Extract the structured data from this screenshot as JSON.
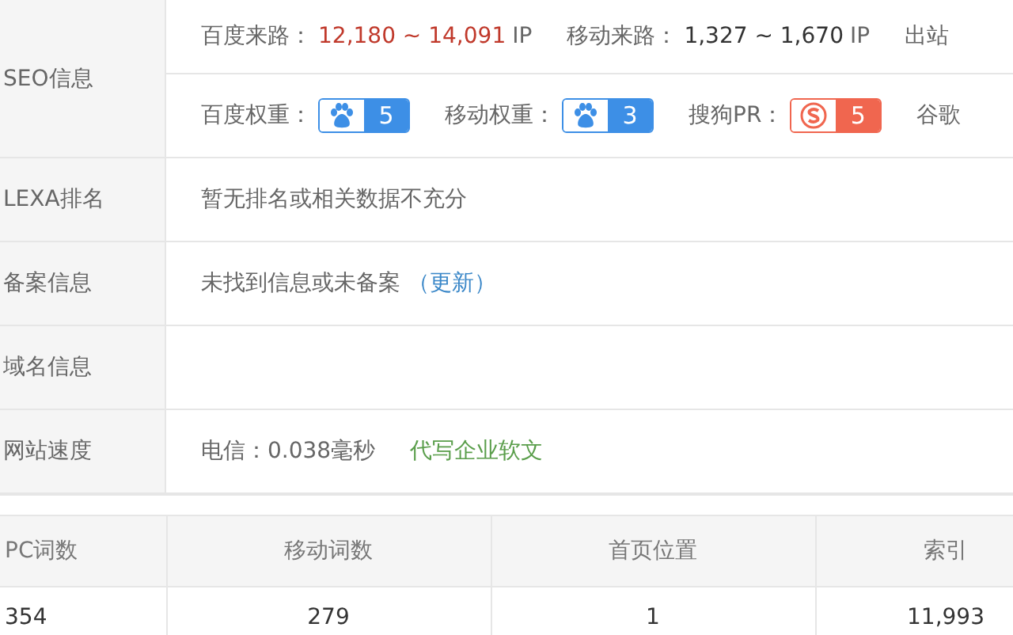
{
  "seo": {
    "label": "SEO信息",
    "traffic": [
      {
        "label": "百度来路：",
        "value": "12,180 ~ 14,091",
        "unit": "IP",
        "highlight": true
      },
      {
        "label": "移动来路：",
        "value": "1,327 ~ 1,670",
        "unit": "IP",
        "highlight": false
      }
    ],
    "traffic_cut": "出站",
    "weights": [
      {
        "label": "百度权重：",
        "kind": "paw",
        "value": "5"
      },
      {
        "label": "移动权重：",
        "kind": "paw-mobile",
        "value": "3"
      },
      {
        "label": "搜狗PR：",
        "kind": "sogou",
        "value": "5"
      }
    ],
    "weights_cut": "谷歌"
  },
  "rows": [
    {
      "label": "LEXA排名",
      "text": "暂无排名或相关数据不充分"
    },
    {
      "label": "备案信息",
      "text": "未找到信息或未备案",
      "link": "（更新）"
    },
    {
      "label": "域名信息"
    },
    {
      "label": "网站速度",
      "text": "电信：0.038毫秒",
      "promo": "代写企业软文"
    }
  ],
  "table": {
    "columns": [
      "PC词数",
      "移动词数",
      "首页位置",
      "索引"
    ],
    "rows": [
      [
        "354",
        "279",
        "1",
        "11,993"
      ]
    ]
  }
}
